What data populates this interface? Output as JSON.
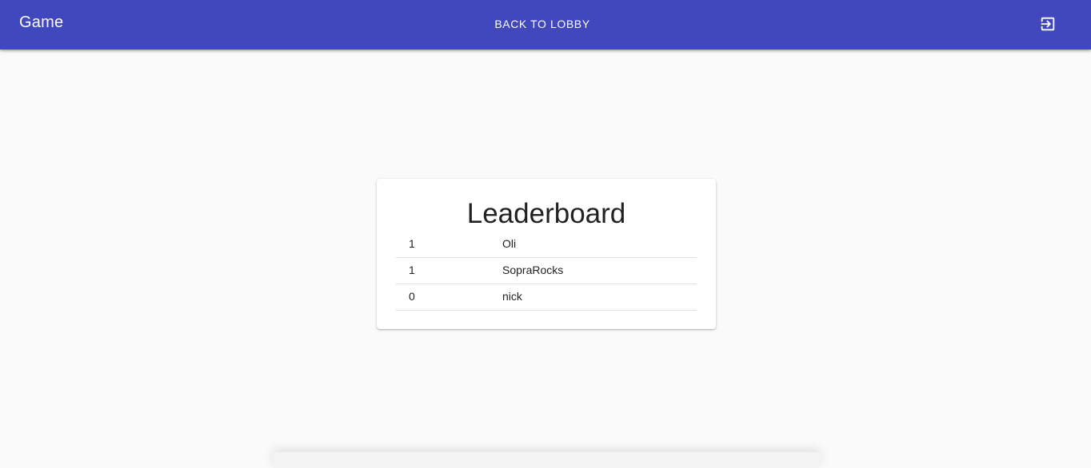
{
  "header": {
    "title": "Game",
    "back_label": "BACK TO LOBBY",
    "logout_icon": "exit-to-app-icon",
    "bar_color": "#4147bc"
  },
  "leaderboard": {
    "title": "Leaderboard",
    "rows": [
      {
        "score": "1",
        "name": "Oli"
      },
      {
        "score": "1",
        "name": "SopraRocks"
      },
      {
        "score": "0",
        "name": "nick"
      }
    ]
  }
}
